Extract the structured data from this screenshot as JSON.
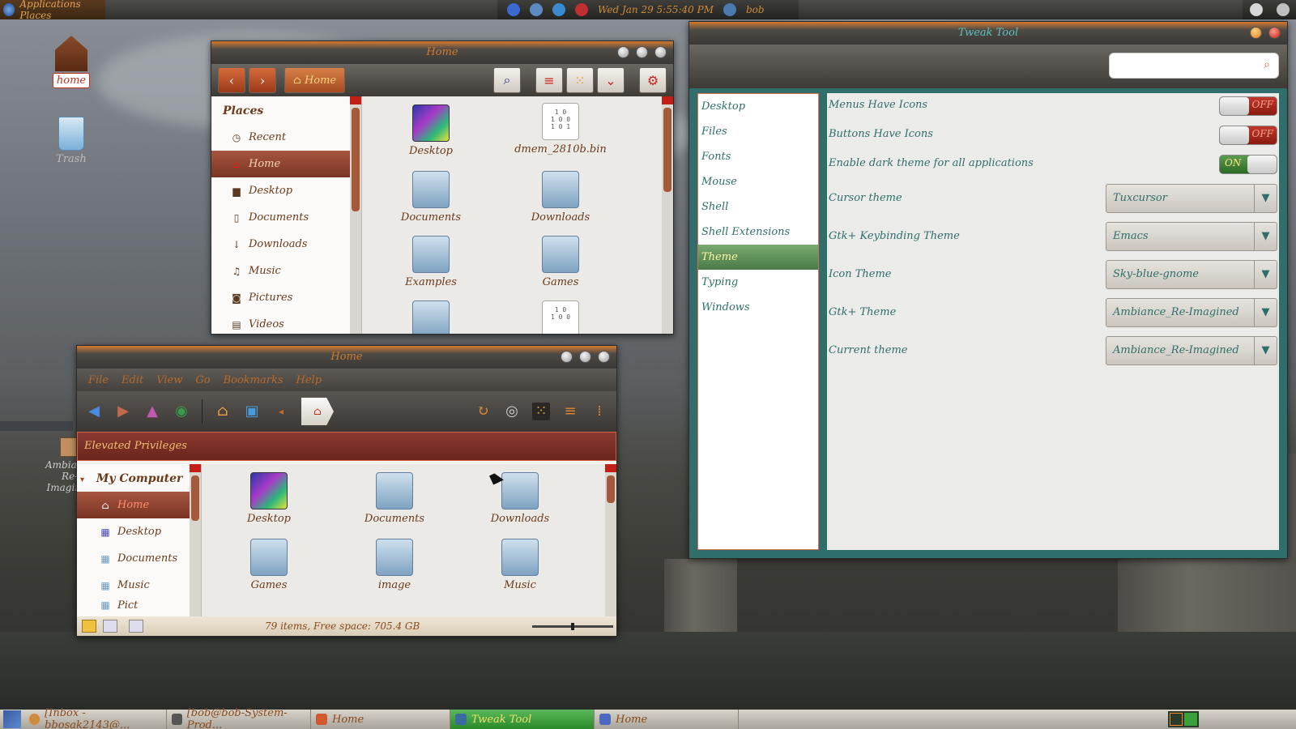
{
  "top_panel": {
    "app_menu_label": "Applications Places",
    "clock": "Wed Jan 29   5:55:40 PM",
    "user": "bob"
  },
  "desktop_icons": [
    {
      "label": "home"
    },
    {
      "label": "Trash"
    },
    {
      "label": "Ambiance Re-Imagined"
    }
  ],
  "nautilus": {
    "title": "Home",
    "path_label": "Home",
    "places_title": "Places",
    "places": [
      {
        "label": "Recent",
        "icon": "clock-icon"
      },
      {
        "label": "Home",
        "icon": "home-icon"
      },
      {
        "label": "Desktop",
        "icon": "folder-icon"
      },
      {
        "label": "Documents",
        "icon": "document-icon"
      },
      {
        "label": "Downloads",
        "icon": "download-icon"
      },
      {
        "label": "Music",
        "icon": "music-icon"
      },
      {
        "label": "Pictures",
        "icon": "camera-icon"
      },
      {
        "label": "Videos",
        "icon": "film-icon"
      }
    ],
    "files": [
      {
        "label": "Desktop"
      },
      {
        "label": "dmem_2810b.bin"
      },
      {
        "label": "Documents"
      },
      {
        "label": "Downloads"
      },
      {
        "label": "Examples"
      },
      {
        "label": "Games"
      }
    ]
  },
  "nemo": {
    "title": "Home",
    "menu": [
      "File",
      "Edit",
      "View",
      "Go",
      "Bookmarks",
      "Help"
    ],
    "elevated_label": "Elevated Privileges",
    "sidebar_title": "My Computer",
    "sidebar": [
      {
        "label": "Home"
      },
      {
        "label": "Desktop"
      },
      {
        "label": "Documents"
      },
      {
        "label": "Music"
      },
      {
        "label": "Pict"
      }
    ],
    "files": [
      {
        "label": "Desktop"
      },
      {
        "label": "Documents"
      },
      {
        "label": "Downloads"
      },
      {
        "label": "Games"
      },
      {
        "label": "image"
      },
      {
        "label": "Music"
      }
    ],
    "status": "79 items, Free space: 705.4 GB"
  },
  "tweak_tool": {
    "title": "Tweak Tool",
    "search_placeholder": "",
    "sections": [
      "Desktop",
      "Files",
      "Fonts",
      "Mouse",
      "Shell",
      "Shell Extensions",
      "Theme",
      "Typing",
      "Windows"
    ],
    "active_section": "Theme",
    "toggles": [
      {
        "label": "Menus Have Icons",
        "state": "OFF"
      },
      {
        "label": "Buttons Have Icons",
        "state": "OFF"
      },
      {
        "label": "Enable dark theme for all applications",
        "state": "ON"
      }
    ],
    "combos": [
      {
        "label": "Cursor theme",
        "value": "Tuxcursor"
      },
      {
        "label": "Gtk+ Keybinding Theme",
        "value": "Emacs"
      },
      {
        "label": "Icon Theme",
        "value": "Sky-blue-gnome"
      },
      {
        "label": "Gtk+ Theme",
        "value": "Ambiance_Re-Imagined"
      },
      {
        "label": "Current theme",
        "value": "Ambiance_Re-Imagined"
      }
    ]
  },
  "taskbar": {
    "tasks": [
      {
        "label": "[Inbox - bbosak2143@..."
      },
      {
        "label": "[bob@bob-System-Prod..."
      },
      {
        "label": "Home"
      },
      {
        "label": "Tweak Tool"
      },
      {
        "label": "Home"
      }
    ]
  },
  "colors": {
    "accent_orange": "#d07a2e",
    "tweak_teal": "#2f6e6a",
    "toggle_off": "#c0392b",
    "toggle_on": "#4a8a40",
    "task_active": "#3aa03a"
  }
}
